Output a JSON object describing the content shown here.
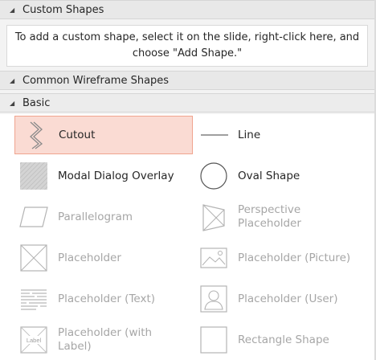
{
  "custom_shapes": {
    "header": "Custom Shapes",
    "message": "To add a custom shape, select it on the slide, right-click here, and choose \"Add Shape.\""
  },
  "common_wireframe": {
    "header": "Common Wireframe Shapes"
  },
  "basic": {
    "header": "Basic",
    "items": [
      {
        "label": "Cutout",
        "icon": "cutout-icon",
        "state": "selected"
      },
      {
        "label": "Line",
        "icon": "line-icon",
        "state": "enabled"
      },
      {
        "label": "Modal Dialog Overlay",
        "icon": "overlay-icon",
        "state": "enabled"
      },
      {
        "label": "Oval Shape",
        "icon": "oval-icon",
        "state": "enabled"
      },
      {
        "label": "Parallelogram",
        "icon": "parallelogram-icon",
        "state": "disabled"
      },
      {
        "label": "Perspective Placeholder",
        "icon": "perspective-placeholder-icon",
        "state": "disabled"
      },
      {
        "label": "Placeholder",
        "icon": "placeholder-icon",
        "state": "disabled"
      },
      {
        "label": "Placeholder (Picture)",
        "icon": "picture-icon",
        "state": "disabled"
      },
      {
        "label": "Placeholder (Text)",
        "icon": "text-lines-icon",
        "state": "disabled"
      },
      {
        "label": "Placeholder (User)",
        "icon": "user-icon",
        "state": "disabled"
      },
      {
        "label": "Placeholder (with Label)",
        "icon": "label-icon",
        "state": "disabled",
        "icon_text": "Label"
      },
      {
        "label": "Rectangle Shape",
        "icon": "rectangle-icon",
        "state": "disabled"
      }
    ]
  },
  "colors": {
    "selected_bg": "#fadbd3",
    "selected_border": "#f0a48f",
    "disabled_text": "#a6a6a6"
  }
}
